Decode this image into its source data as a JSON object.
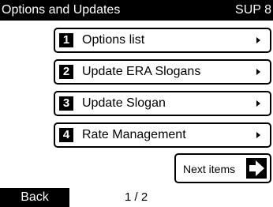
{
  "header": {
    "title": "Options and Updates",
    "code": "SUP 8"
  },
  "menu": {
    "items": [
      {
        "number": "1",
        "label": "Options list",
        "icon": "chevron-right-icon"
      },
      {
        "number": "2",
        "label": "Update ERA Slogans",
        "icon": "chevron-right-icon"
      },
      {
        "number": "3",
        "label": "Update Slogan",
        "icon": "chevron-right-icon"
      },
      {
        "number": "4",
        "label": "Rate Management",
        "icon": "chevron-right-icon"
      }
    ]
  },
  "next_button": {
    "label": "Next items",
    "icon": "arrow-right-icon"
  },
  "footer": {
    "back_label": "Back",
    "page_indicator": "1 / 2"
  },
  "colors": {
    "header_bg": "#000000",
    "header_text": "#ffffff",
    "background": "#ffffff",
    "border": "#000000"
  }
}
